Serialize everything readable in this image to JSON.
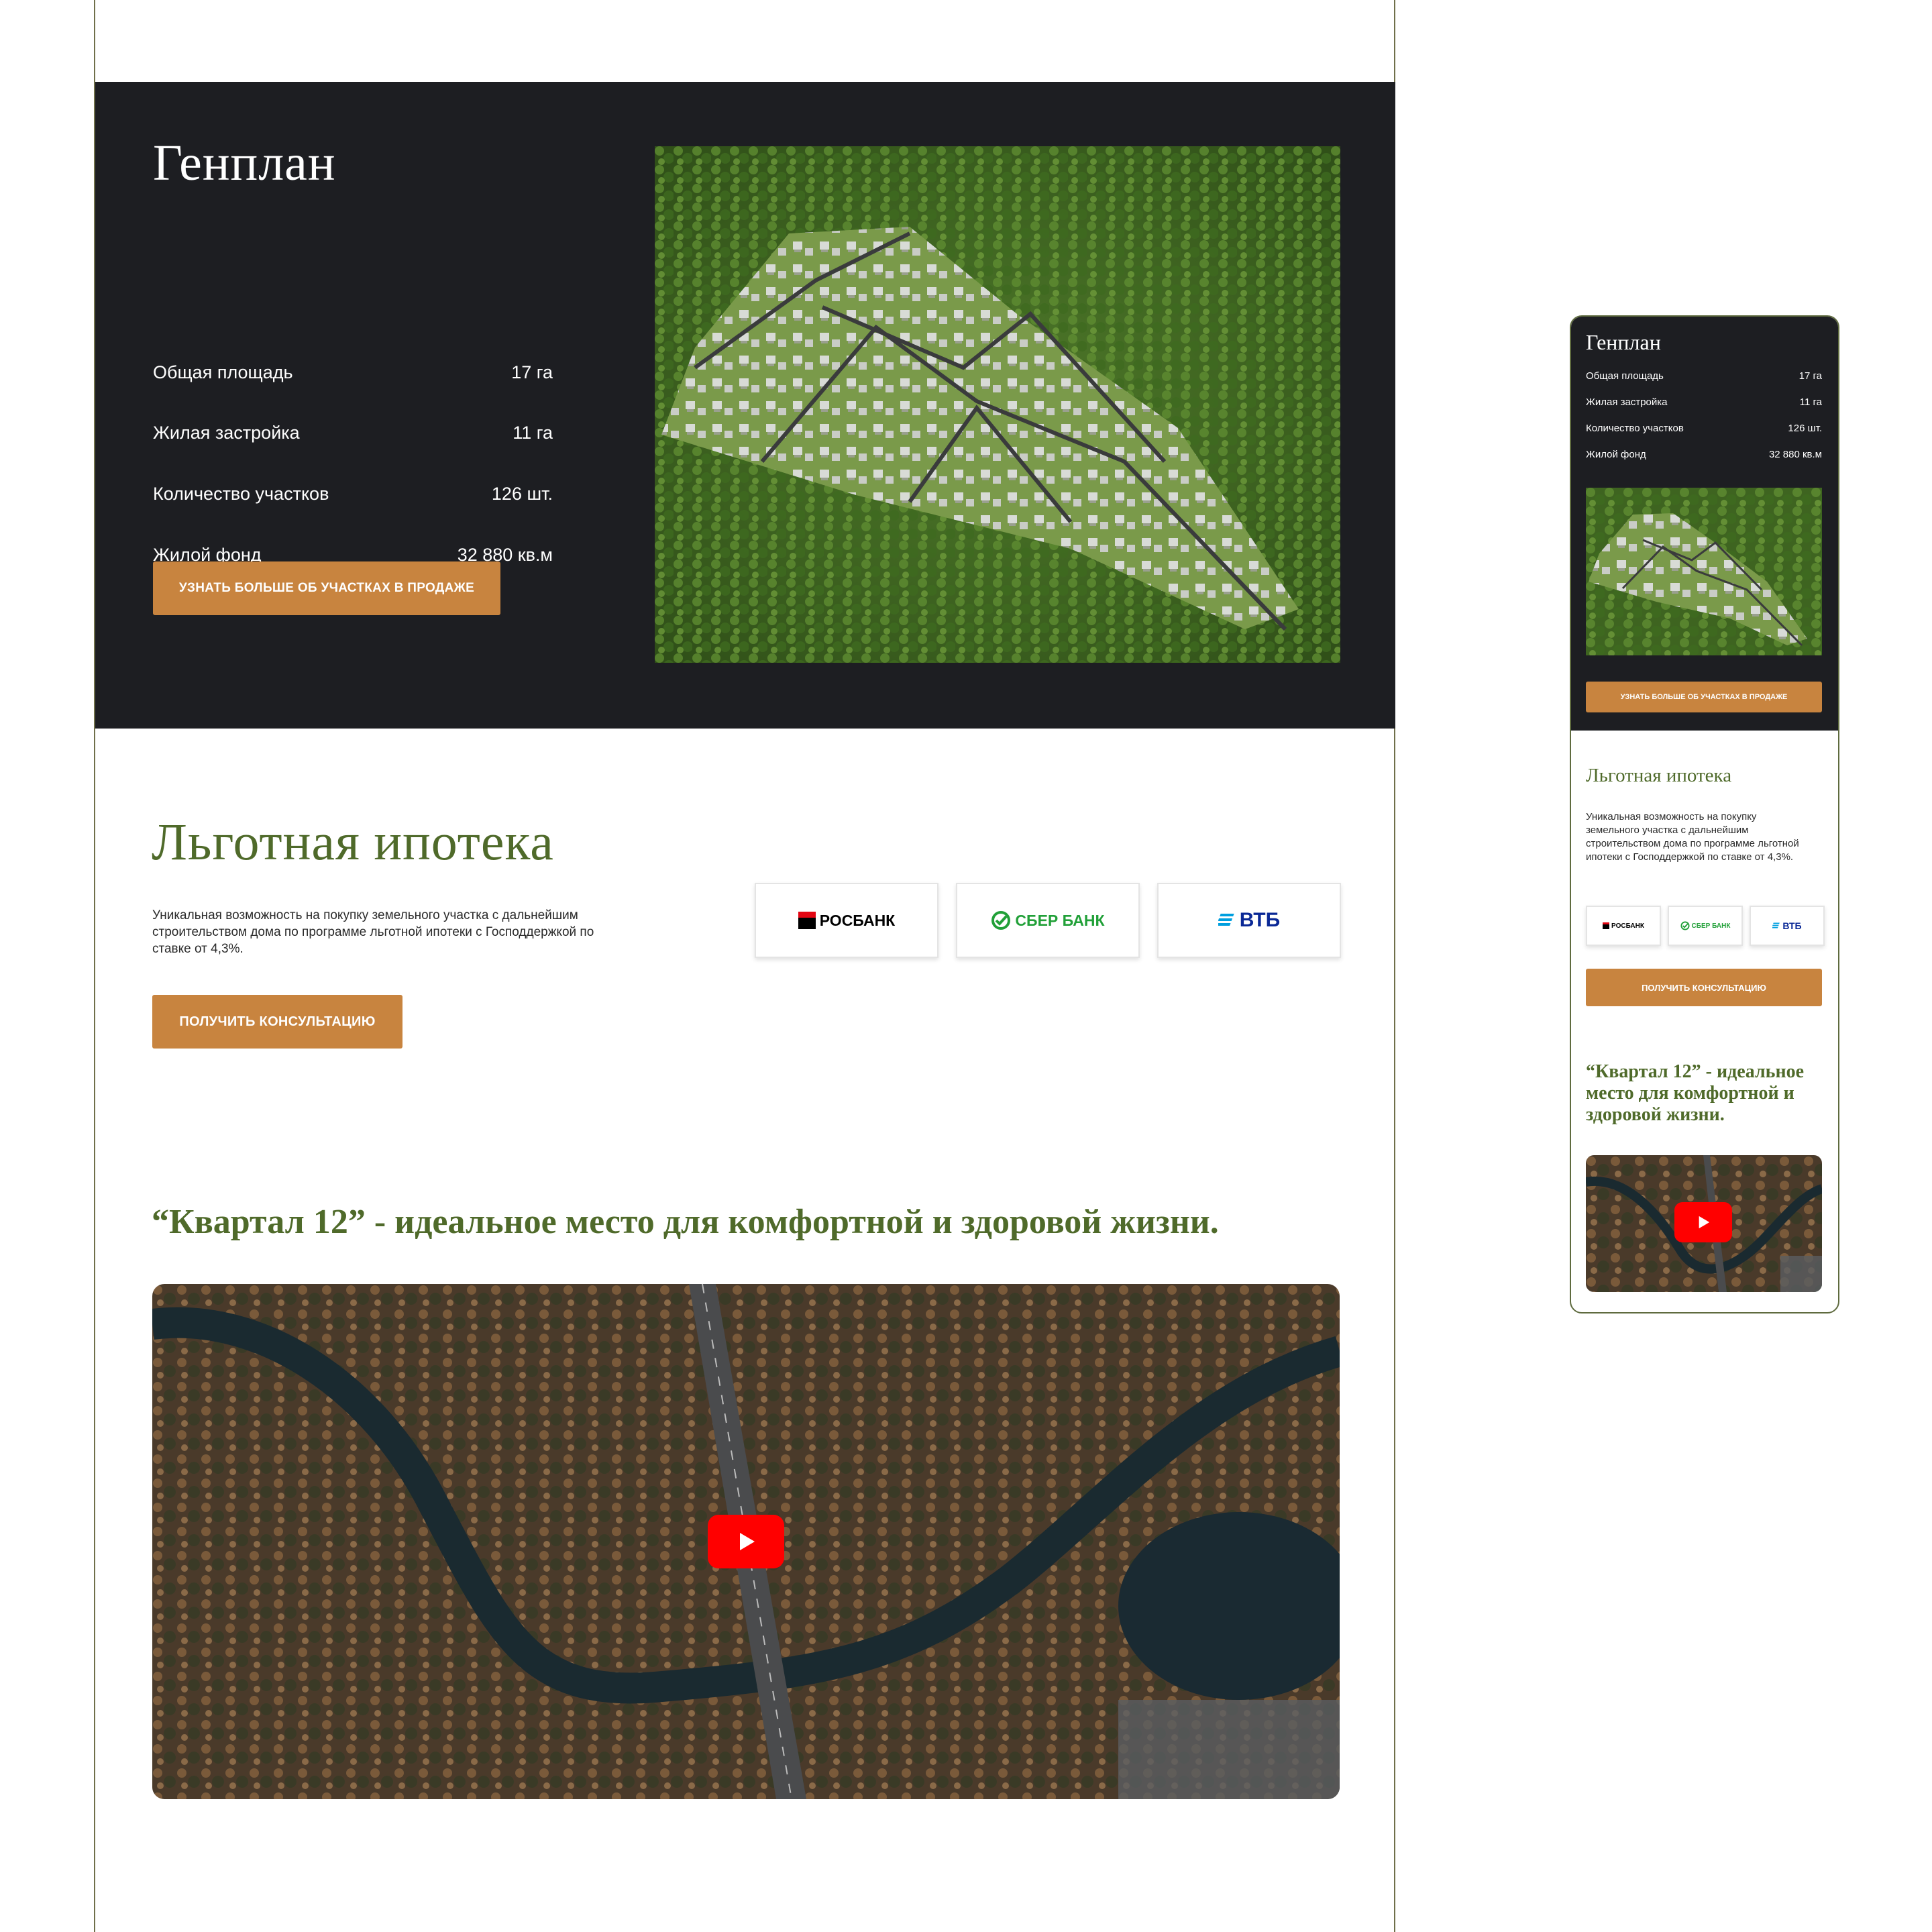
{
  "genplan": {
    "title": "Генплан",
    "stats": [
      {
        "label": "Общая площадь",
        "value": "17 га"
      },
      {
        "label": "Жилая застройка",
        "value": "11 га"
      },
      {
        "label": "Количество участков",
        "value": "126 шт."
      },
      {
        "label": "Жилой фонд",
        "value": "32 880 кв.м"
      }
    ],
    "button_label": "Узнать больше об участках в продаже"
  },
  "mortgage": {
    "title": "Льготная ипотека",
    "description": "Уникальная возможность на покупку земельного участка с дальнейшим строительством дома по программе льготной ипотеки  с Господдержкой по ставке от 4,3%.",
    "button_label": "Получить консультацию",
    "banks": [
      {
        "name": "РОСБАНК",
        "color": "#000000"
      },
      {
        "name": "СБЕР БАНК",
        "color": "#21a038"
      },
      {
        "name": "ВТБ",
        "color": "#0a2896"
      }
    ]
  },
  "kvartal": {
    "title": "“Квартал 12” - идеальное место для комфортной и здоровой жизни."
  },
  "colors": {
    "dark_bg": "#1d1e22",
    "accent_orange": "#c8843f",
    "heading_green": "#4f6a2a",
    "youtube_red": "#ff0000"
  }
}
